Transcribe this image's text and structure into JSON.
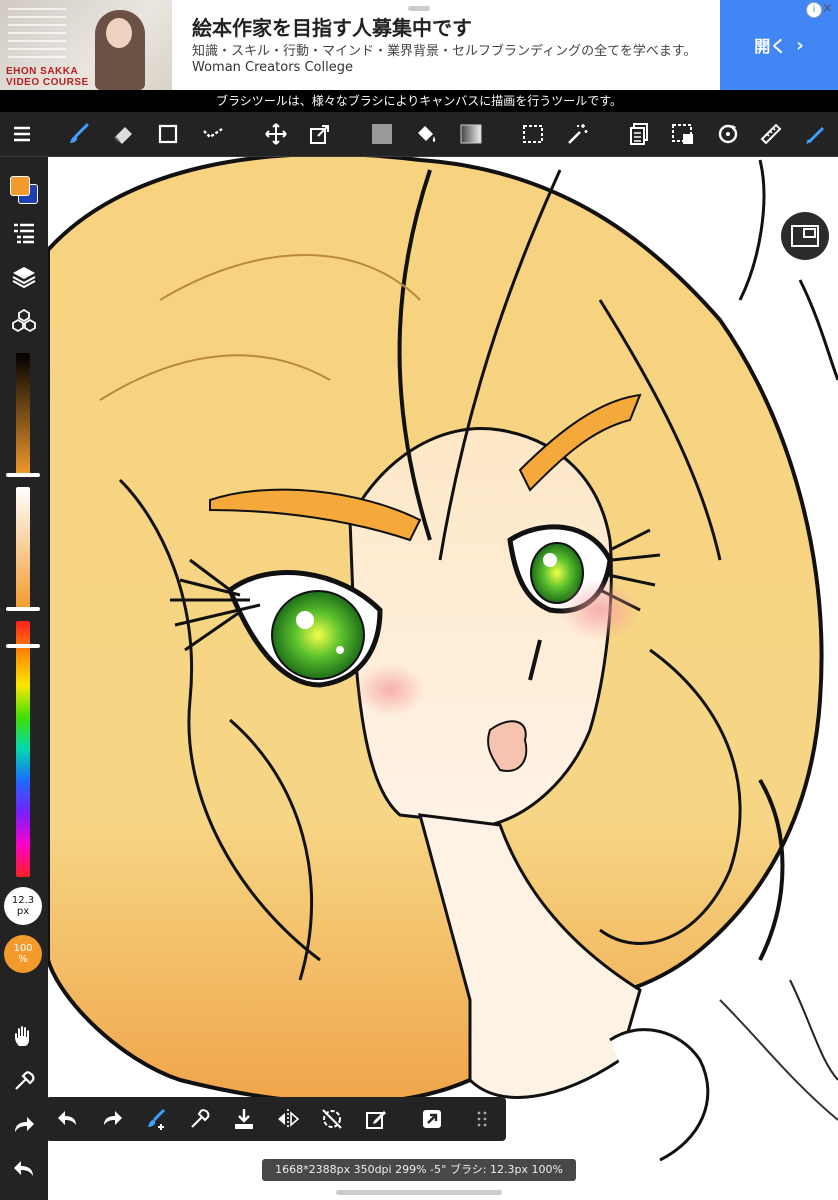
{
  "ad": {
    "title": "絵本作家を目指す人募集中です",
    "description": "知識・スキル・行動・マインド・業界背景・セルフブランディングの全てを学べます。",
    "brand": "Woman Creators College",
    "cta_label": "開く",
    "thumb_tag_line1": "EHON SAKKA",
    "thumb_tag_line2": "VIDEO COURSE",
    "info_icon": "i",
    "close_icon": "×"
  },
  "tooltip": "ブラシツールは、様々なブラシによりキャンバスに描画を行うツールです。",
  "toolbar": {
    "items": [
      "menu-icon",
      "brush-icon",
      "eraser-icon",
      "shape-icon",
      "dot-icon",
      "move-icon",
      "transform-icon",
      "fill-rect-icon",
      "bucket-icon",
      "gradient-icon",
      "select-icon",
      "magic-wand-icon",
      "layer-panel-icon",
      "select-layer-icon",
      "rotate-icon",
      "ruler-icon",
      "pen-active-icon"
    ]
  },
  "sidebar": {
    "primary_color": "#f39a2c",
    "secondary_color": "#1d3fb0",
    "size_value": "12.3",
    "size_unit": "px",
    "opacity_value": "100",
    "opacity_unit": "%"
  },
  "bottombar": {
    "items": [
      "undo-icon",
      "redo-icon",
      "brush-settings-icon",
      "eyedropper-icon",
      "import-icon",
      "flip-icon",
      "rotate-reset-icon",
      "edit-icon",
      "share-icon",
      "grid-menu-icon"
    ]
  },
  "status": "1668*2388px 350dpi 299% -5° ブラシ: 12.3px 100%",
  "colors": {
    "accent": "#4285f4",
    "toolbar_bg": "#232323",
    "brush_blue": "#3fa0ff"
  }
}
